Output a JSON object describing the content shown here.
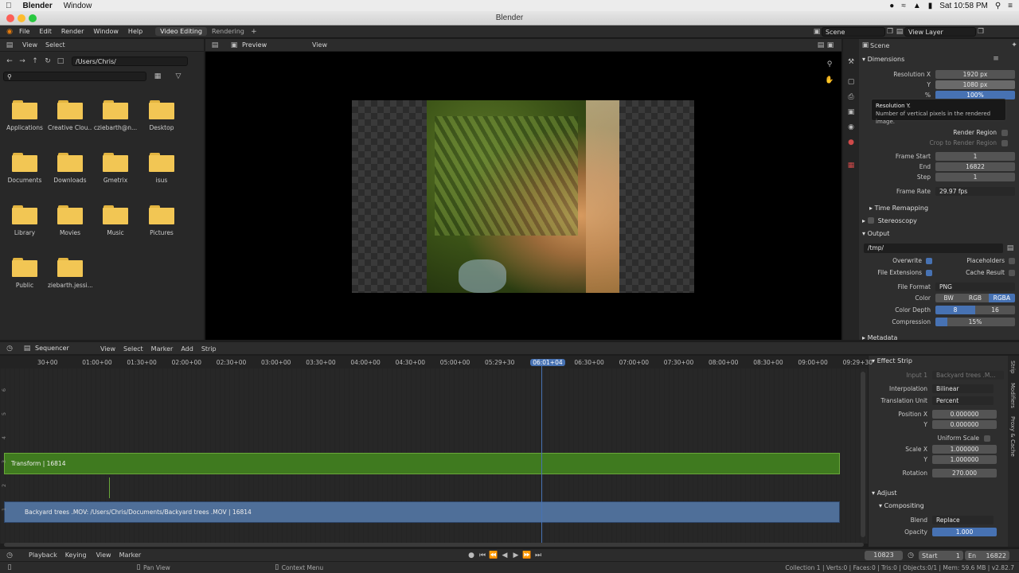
{
  "mac_menu": {
    "app": "Blender",
    "window": "Window",
    "clock": "Sat 10:58 PM"
  },
  "window_title": "Blender",
  "topbar": {
    "menus": [
      "File",
      "Edit",
      "Render",
      "Window",
      "Help"
    ],
    "workspaces": [
      "Video Editing",
      "Rendering"
    ],
    "scene": "Scene",
    "view_layer": "View Layer"
  },
  "file_browser": {
    "menus": [
      "View",
      "Select"
    ],
    "path": "/Users/Chris/",
    "items": [
      "Applications",
      "Creative Clou...",
      "cziebarth@n...",
      "Desktop",
      "Documents",
      "Downloads",
      "Gmetrix",
      "isus",
      "Library",
      "Movies",
      "Music",
      "Pictures",
      "Public",
      "ziebarth.jessi..."
    ]
  },
  "preview": {
    "mode": "Preview",
    "menu": "View"
  },
  "properties": {
    "scene": "Scene",
    "dimensions_title": "Dimensions",
    "res_x_label": "Resolution X",
    "res_x": "1920 px",
    "res_y_label": "Y",
    "res_y": "1080 px",
    "pct_label": "%",
    "pct": "100%",
    "tooltip_title": "Resolution Y.",
    "tooltip_desc": "Number of vertical pixels in the rendered image.",
    "render_region": "Render Region",
    "crop_region": "Crop to Render Region",
    "frame_start_label": "Frame Start",
    "frame_start": "1",
    "end_label": "End",
    "end": "16822",
    "step_label": "Step",
    "step": "1",
    "frame_rate_label": "Frame Rate",
    "frame_rate": "29.97 fps",
    "time_remapping": "Time Remapping",
    "stereoscopy": "Stereoscopy",
    "output_title": "Output",
    "output_path": "/tmp/",
    "overwrite": "Overwrite",
    "placeholders": "Placeholders",
    "file_ext": "File Extensions",
    "cache_result": "Cache Result",
    "file_format_label": "File Format",
    "file_format": "PNG",
    "color_label": "Color",
    "color_opts": [
      "BW",
      "RGB",
      "RGBA"
    ],
    "depth_label": "Color Depth",
    "depth_opts": [
      "8",
      "16"
    ],
    "compression_label": "Compression",
    "compression": "15%",
    "compression_fraction": 0.15,
    "metadata": "Metadata"
  },
  "sequencer": {
    "editor": "Sequencer",
    "menus": [
      "View",
      "Select",
      "Marker",
      "Add",
      "Strip"
    ],
    "ticks": [
      "30+00",
      "01:00+00",
      "01:30+00",
      "02:00+00",
      "02:30+00",
      "03:00+00",
      "03:30+00",
      "04:00+00",
      "04:30+00",
      "05:00+00",
      "05:29+30",
      "06:01+04",
      "06:30+00",
      "07:00+00",
      "07:30+00",
      "08:00+00",
      "08:30+00",
      "09:00+00",
      "09:29+30"
    ],
    "current": "06:01+04",
    "channels": [
      "6",
      "5",
      "4",
      "3",
      "2",
      "1"
    ],
    "transform_strip": "Transform | 16814",
    "movie_strip": "Backyard trees .MOV: /Users/Chris/Documents/Backyard trees .MOV | 16814"
  },
  "strip_panel": {
    "effect_title": "Effect Strip",
    "input_label": "Input 1",
    "input": "Backyard trees .M...",
    "interp_label": "Interpolation",
    "interp": "Bilinear",
    "trans_unit_label": "Translation Unit",
    "trans_unit": "Percent",
    "pos_x_label": "Position X",
    "pos_x": "0.000000",
    "pos_y_label": "Y",
    "pos_y": "0.000000",
    "uniform_label": "Uniform Scale",
    "scale_x_label": "Scale X",
    "scale_x": "1.000000",
    "scale_y_label": "Y",
    "scale_y": "1.000000",
    "rotation_label": "Rotation",
    "rotation": "270.000",
    "adjust_title": "Adjust",
    "compositing_title": "Compositing",
    "blend_label": "Blend",
    "blend": "Replace",
    "opacity_label": "Opacity",
    "opacity": "1.000",
    "tabs": [
      "Strip",
      "Modifiers",
      "Proxy & Cache"
    ]
  },
  "timeline": {
    "menus": [
      "Playback",
      "Keying",
      "View",
      "Marker"
    ],
    "frame": "10823",
    "start_label": "Start",
    "start": "1",
    "end_label": "En",
    "end": "16822"
  },
  "statusbar": {
    "pan": "Pan View",
    "context": "Context Menu",
    "stats": "Collection 1 | Verts:0 | Faces:0 | Tris:0 | Objects:0/1 | Mem: 59.6 MB | v2.82.7"
  },
  "colors": {
    "accent": "#4772b3",
    "transform_strip": "#3f7a1f",
    "movie_strip": "#4f6f99",
    "folder": "#f2c654"
  }
}
